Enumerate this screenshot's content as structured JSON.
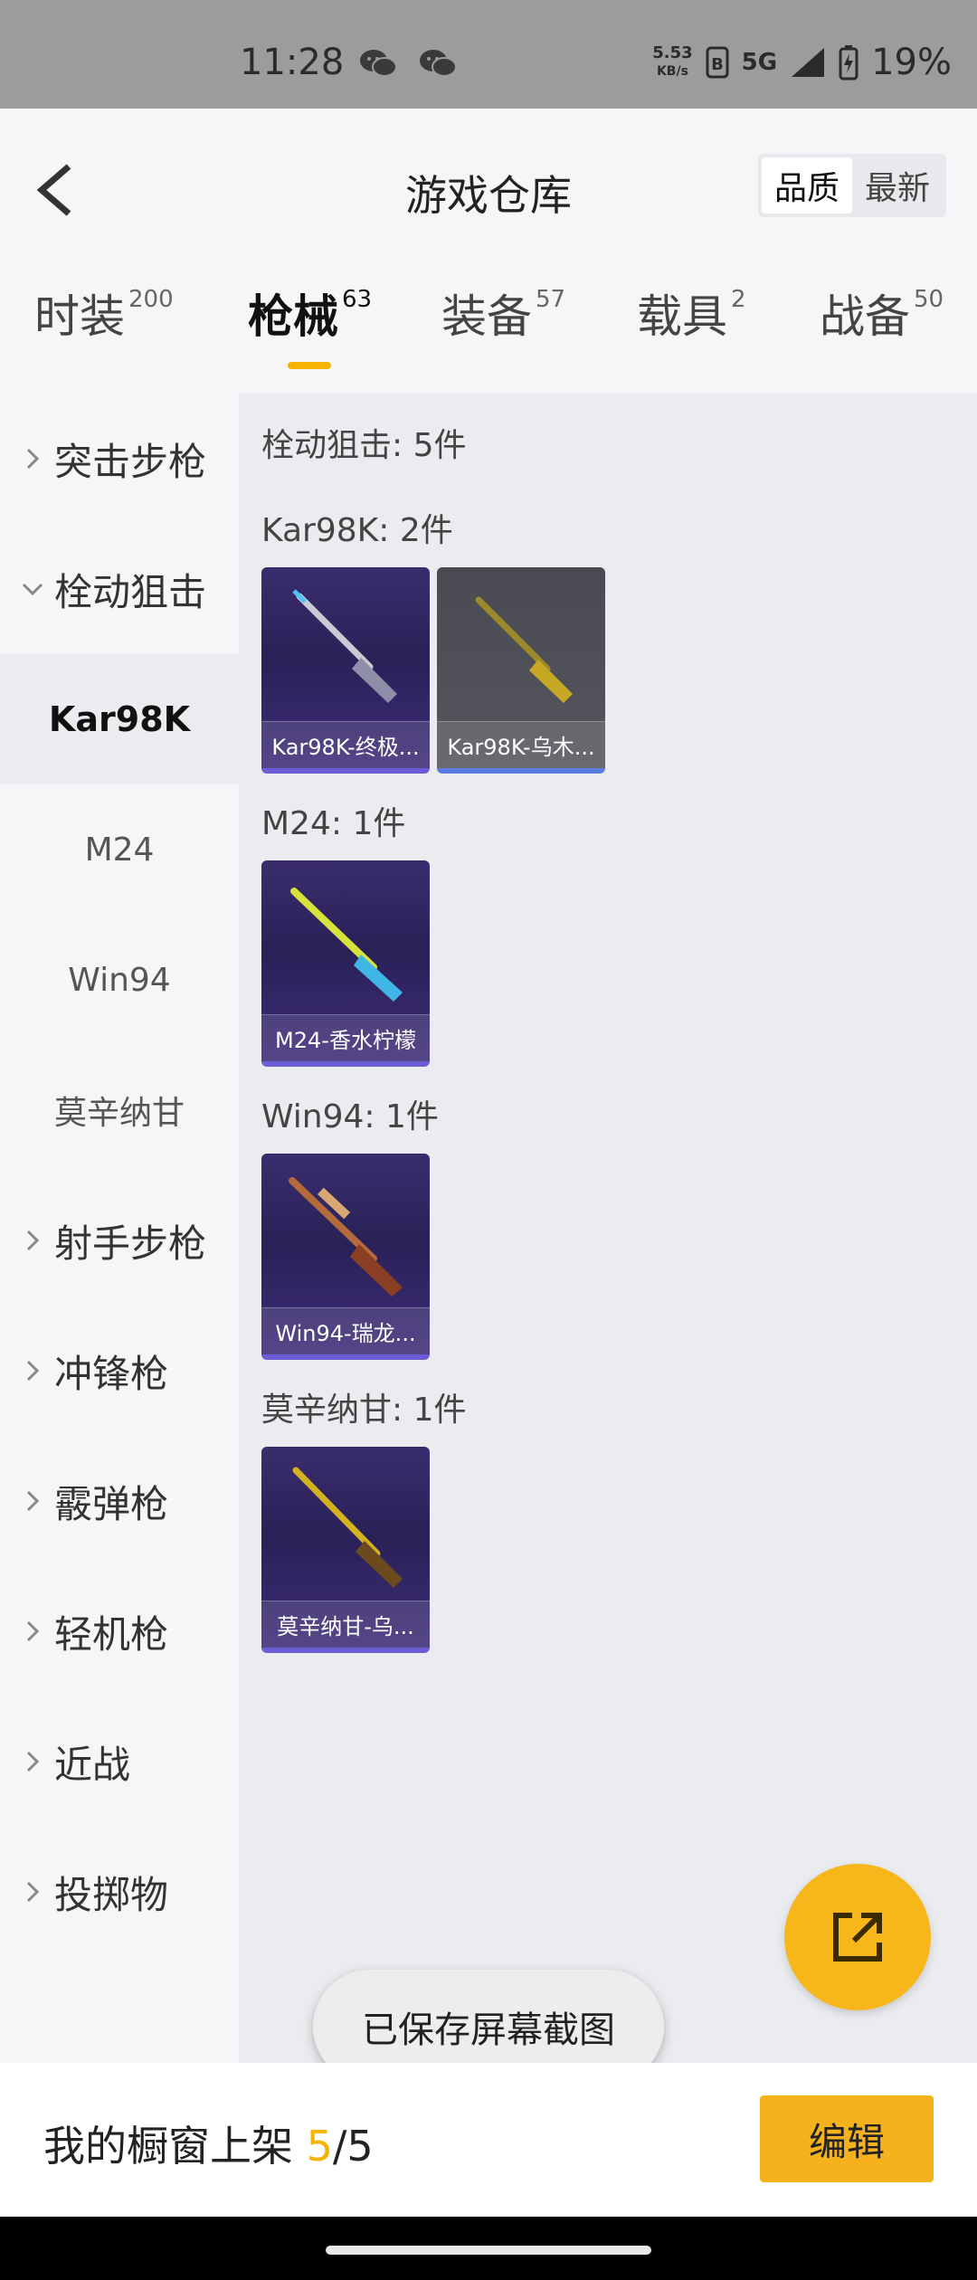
{
  "status_bar": {
    "time": "11:28",
    "speed_value": "5.53",
    "speed_unit": "KB/s",
    "network": "5G",
    "battery": "19%"
  },
  "header": {
    "title": "游戏仓库",
    "sort_options": [
      "品质",
      "最新"
    ],
    "active_sort": "品质"
  },
  "tabs": [
    {
      "label": "时装",
      "count": "200"
    },
    {
      "label": "枪械",
      "count": "63"
    },
    {
      "label": "装备",
      "count": "57"
    },
    {
      "label": "载具",
      "count": "2"
    },
    {
      "label": "战备",
      "count": "50"
    }
  ],
  "sidebar": {
    "categories": [
      {
        "label": "突击步枪"
      },
      {
        "label": "栓动狙击"
      },
      {
        "label": "射手步枪"
      },
      {
        "label": "冲锋枪"
      },
      {
        "label": "霰弹枪"
      },
      {
        "label": "轻机枪"
      },
      {
        "label": "近战"
      },
      {
        "label": "投掷物"
      }
    ],
    "subcategories": [
      "Kar98K",
      "M24",
      "Win94",
      "莫辛纳甘"
    ]
  },
  "content": {
    "header": "栓动狙击: 5件",
    "groups": [
      {
        "title": "Kar98K: 2件",
        "items": [
          "Kar98K-终极...",
          "Kar98K-乌木..."
        ]
      },
      {
        "title": "M24: 1件",
        "items": [
          "M24-香水柠檬"
        ]
      },
      {
        "title": "Win94: 1件",
        "items": [
          "Win94-瑞龙..."
        ]
      },
      {
        "title": "莫辛纳甘: 1件",
        "items": [
          "莫辛纳甘-乌..."
        ]
      }
    ]
  },
  "toast": "已保存屏幕截图",
  "bottom_bar": {
    "showcase_label": "我的橱窗上架",
    "showcase_current": "5",
    "showcase_sep": "/",
    "showcase_total": "5",
    "edit_label": "编辑"
  },
  "colors": {
    "accent": "#f5b400",
    "card_purple": "#2a2157",
    "card_grey": "#4f4f57"
  }
}
